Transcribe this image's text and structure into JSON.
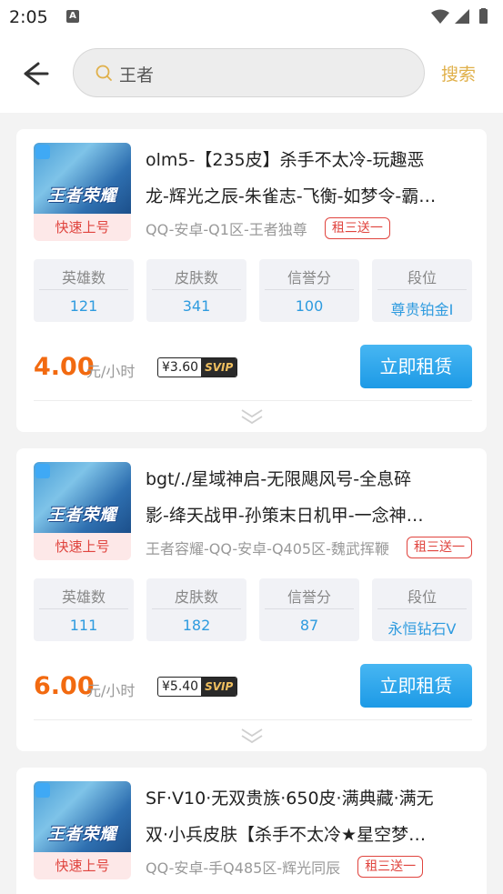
{
  "status_bar": {
    "time": "2:05",
    "badge": "A"
  },
  "search": {
    "back_icon": "arrow-left-icon",
    "search_icon": "search-icon",
    "value": "王者",
    "button_label": "搜索"
  },
  "listings": [
    {
      "cover_logo": "王者荣耀",
      "cover_tag": "快速上号",
      "title_lines": [
        "olm5-【235皮】杀手不太冷-玩趣恶",
        "龙-辉光之辰-朱雀志-飞衡-如梦令-霸…"
      ],
      "meta": "QQ-安卓-Q1区-王者独尊",
      "promo": "租三送一",
      "stats": [
        {
          "label": "英雄数",
          "value": "121"
        },
        {
          "label": "皮肤数",
          "value": "341"
        },
        {
          "label": "信誉分",
          "value": "100"
        },
        {
          "label": "段位",
          "value": "尊贵铂金I"
        }
      ],
      "price": "4.00",
      "unit": "元/小时",
      "svip_price": "¥3.60",
      "svip_tag": "SVIP",
      "rent_label": "立即租赁"
    },
    {
      "cover_logo": "王者荣耀",
      "cover_tag": "快速上号",
      "title_lines": [
        "bgt/./星域神启-无限飓风号-全息碎",
        "影-绛天战甲-孙策末日机甲-一念神…"
      ],
      "meta": "王者容耀-QQ-安卓-Q405区-魏武挥鞭",
      "promo": "租三送一",
      "stats": [
        {
          "label": "英雄数",
          "value": "111"
        },
        {
          "label": "皮肤数",
          "value": "182"
        },
        {
          "label": "信誉分",
          "value": "87"
        },
        {
          "label": "段位",
          "value": "永恒钻石V"
        }
      ],
      "price": "6.00",
      "unit": "元/小时",
      "svip_price": "¥5.40",
      "svip_tag": "SVIP",
      "rent_label": "立即租赁"
    },
    {
      "cover_logo": "王者荣耀",
      "cover_tag": "快速上号",
      "title_lines": [
        "SF·V10·无双贵族·650皮·满典藏·满无",
        "双·小兵皮肤【杀手不太冷★星空梦…"
      ],
      "meta": "QQ-安卓-手Q485区-辉光同辰",
      "promo": "租三送一"
    }
  ],
  "colors": {
    "accent": "#2e9bdf",
    "price": "#f26a10",
    "tag": "#e0443e",
    "search_button": "#e0b04a"
  }
}
